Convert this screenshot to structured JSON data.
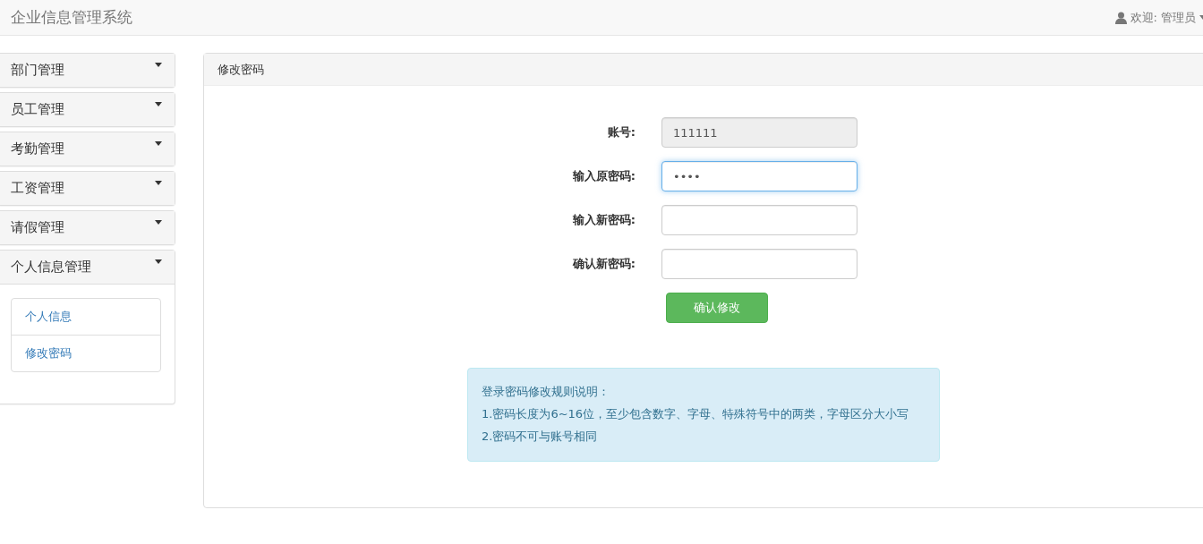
{
  "navbar": {
    "brand": "企业信息管理系统",
    "welcome": "欢迎:",
    "user": "管理员"
  },
  "sidebar": {
    "items": [
      {
        "label": "部门管理",
        "expanded": false
      },
      {
        "label": "员工管理",
        "expanded": false
      },
      {
        "label": "考勤管理",
        "expanded": false
      },
      {
        "label": "工资管理",
        "expanded": false
      },
      {
        "label": "请假管理",
        "expanded": false
      },
      {
        "label": "个人信息管理",
        "expanded": true,
        "children": [
          {
            "label": "个人信息"
          },
          {
            "label": "修改密码"
          }
        ]
      }
    ]
  },
  "panel": {
    "title": "修改密码",
    "fields": [
      {
        "label": "账号:",
        "value": "111111",
        "kind": "readonly",
        "focused": false
      },
      {
        "label": "输入原密码:",
        "value": "••••",
        "kind": "password",
        "focused": true
      },
      {
        "label": "输入新密码:",
        "kind": "password",
        "focused": false
      },
      {
        "label": "确认新密码:",
        "kind": "password",
        "focused": false
      }
    ],
    "submit": "确认修改",
    "notice": {
      "title": "登录密码修改规则说明：",
      "rules": [
        "1.密码长度为6~16位，至少包含数字、字母、特殊符号中的两类，字母区分大小写",
        "2.密码不可与账号相同"
      ]
    }
  }
}
